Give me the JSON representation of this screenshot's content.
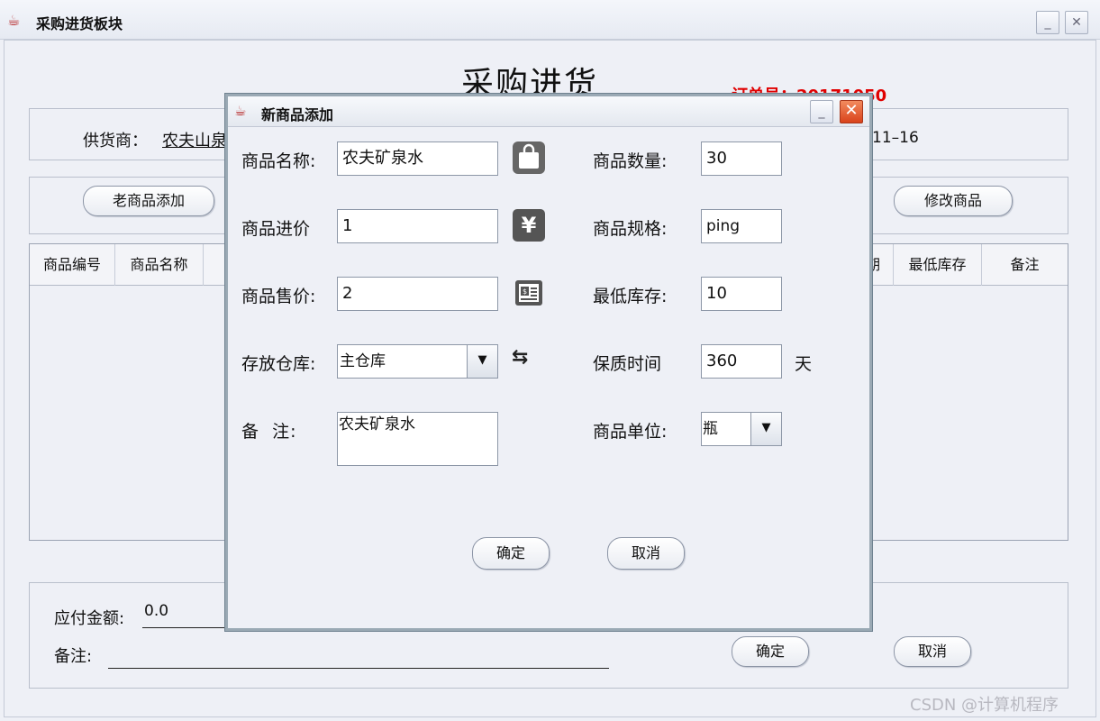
{
  "main_window": {
    "title": "采购进货板块",
    "heading": "采购进货",
    "order_number": "订单号：20171050",
    "supplier_label": "供货商：",
    "supplier_value": "农夫山泉",
    "date_value": "11–16",
    "buttons": {
      "old_goods": "老商品添加",
      "modify_goods": "修改商品",
      "ok": "确定",
      "cancel": "取消"
    },
    "table": {
      "columns": [
        "商品编号",
        "商品名称",
        "期",
        "最低库存",
        "备注"
      ],
      "rows": []
    },
    "payable_label": "应付金额:",
    "payable_value": "0.0",
    "remark_label": "备注:"
  },
  "dialog": {
    "title": "新商品添加",
    "fields": {
      "name": {
        "label": "商品名称:",
        "value": "农夫矿泉水"
      },
      "quantity": {
        "label": "商品数量:",
        "value": "30"
      },
      "cost": {
        "label": "商品进价",
        "value": "1"
      },
      "spec": {
        "label": "商品规格:",
        "value": "ping"
      },
      "price": {
        "label": "商品售价:",
        "value": "2"
      },
      "min_stock": {
        "label": "最低库存:",
        "value": "10"
      },
      "warehouse": {
        "label": "存放仓库:",
        "value": "主仓库"
      },
      "shelf_life": {
        "label": "保质时间",
        "value": "360",
        "unit": "天"
      },
      "note": {
        "label": "备  注:",
        "value": "农夫矿泉水"
      },
      "unit": {
        "label": "商品单位:",
        "value": "瓶"
      }
    },
    "buttons": {
      "ok": "确定",
      "cancel": "取消"
    },
    "icons": {
      "name": "shopping-bag-icon",
      "cost": "yen-icon",
      "price": "bill-icon",
      "warehouse": "refresh-icon"
    }
  },
  "watermark": "CSDN @计算机程序",
  "colors": {
    "order_number": "#e00000",
    "close_button": "#d9421b",
    "window_background": "#eef0f6"
  }
}
